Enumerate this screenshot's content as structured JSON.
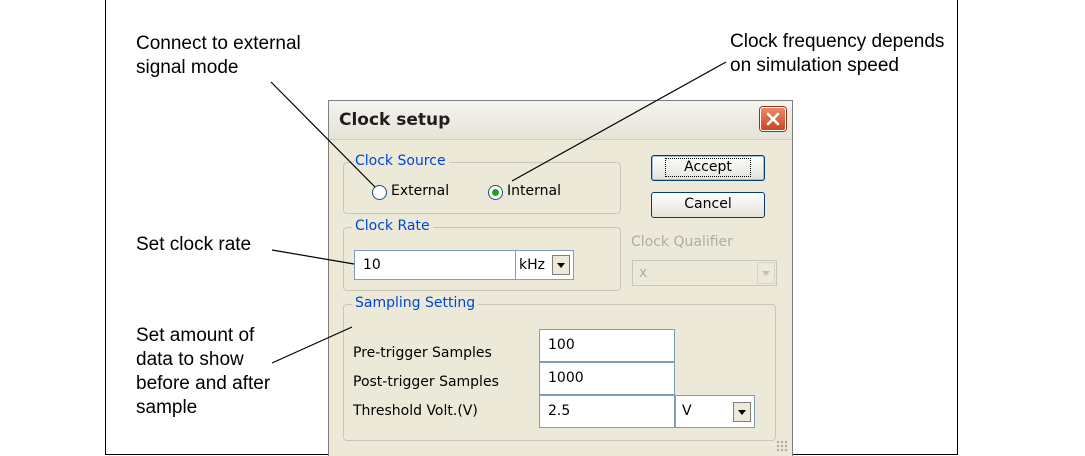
{
  "callouts": {
    "external_mode": "Connect to external\nsignal mode",
    "clock_frequency": "Clock frequency depends\non simulation speed",
    "clock_rate": "Set clock rate",
    "data_amount": "Set amount of\ndata to show\nbefore and after\nsample"
  },
  "dialog": {
    "title": "Clock setup",
    "clock_source": {
      "legend": "Clock Source",
      "options": [
        "External",
        "Internal"
      ],
      "selected": "Internal"
    },
    "buttons": {
      "accept": "Accept",
      "cancel": "Cancel"
    },
    "clock_rate": {
      "legend": "Clock Rate",
      "value": "10",
      "unit": "kHz"
    },
    "clock_qualifier": {
      "label": "Clock Qualifier",
      "value": "x"
    },
    "sampling": {
      "legend": "Sampling Setting",
      "pre_trigger": {
        "label": "Pre-trigger Samples",
        "value": "100"
      },
      "post_trigger": {
        "label": "Post-trigger Samples",
        "value": "1000"
      },
      "threshold": {
        "label": "Threshold Volt.(V)",
        "value": "2.5",
        "unit": "V"
      }
    }
  },
  "icons": [
    "close-icon",
    "dropdown-arrow-icon",
    "resize-grip-icon"
  ],
  "colors": {
    "legend_text": "#0046d5",
    "dialog_bg": "#ece9d8",
    "close_red": "#d3562f",
    "radio_dot": "#21a121"
  }
}
